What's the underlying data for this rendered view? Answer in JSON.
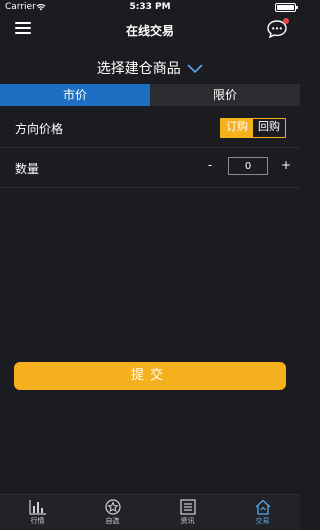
{
  "status_bar": {
    "carrier": "Carrier",
    "time": "5:33 PM"
  },
  "nav": {
    "title": "在线交易",
    "menu_icon": "hamburger-icon",
    "chat_icon": "chat-bubble-icon"
  },
  "product_selector": {
    "label": "选择建仓商品",
    "icon": "chevron-down-icon"
  },
  "order_tabs": [
    {
      "label": "市价",
      "active": true
    },
    {
      "label": "限价",
      "active": false
    }
  ],
  "direction": {
    "label": "方向价格",
    "buy_label": "订购",
    "sell_label": "回购",
    "selected": "订购"
  },
  "quantity": {
    "label": "数量",
    "minus": "-",
    "value": "0",
    "plus": "+"
  },
  "submit": {
    "label": "提交"
  },
  "bottom_tabs": [
    {
      "label": "行情",
      "icon": "bar-chart-icon",
      "active": false
    },
    {
      "label": "自选",
      "icon": "star-icon",
      "active": false
    },
    {
      "label": "资讯",
      "icon": "news-icon",
      "active": false
    },
    {
      "label": "交易",
      "icon": "home-trade-icon",
      "active": true
    }
  ],
  "colors": {
    "accent_blue": "#1e6fc4",
    "accent_yellow": "#f5b11d",
    "background": "#1b1c20",
    "active_tab_text": "#5aa6e8"
  }
}
